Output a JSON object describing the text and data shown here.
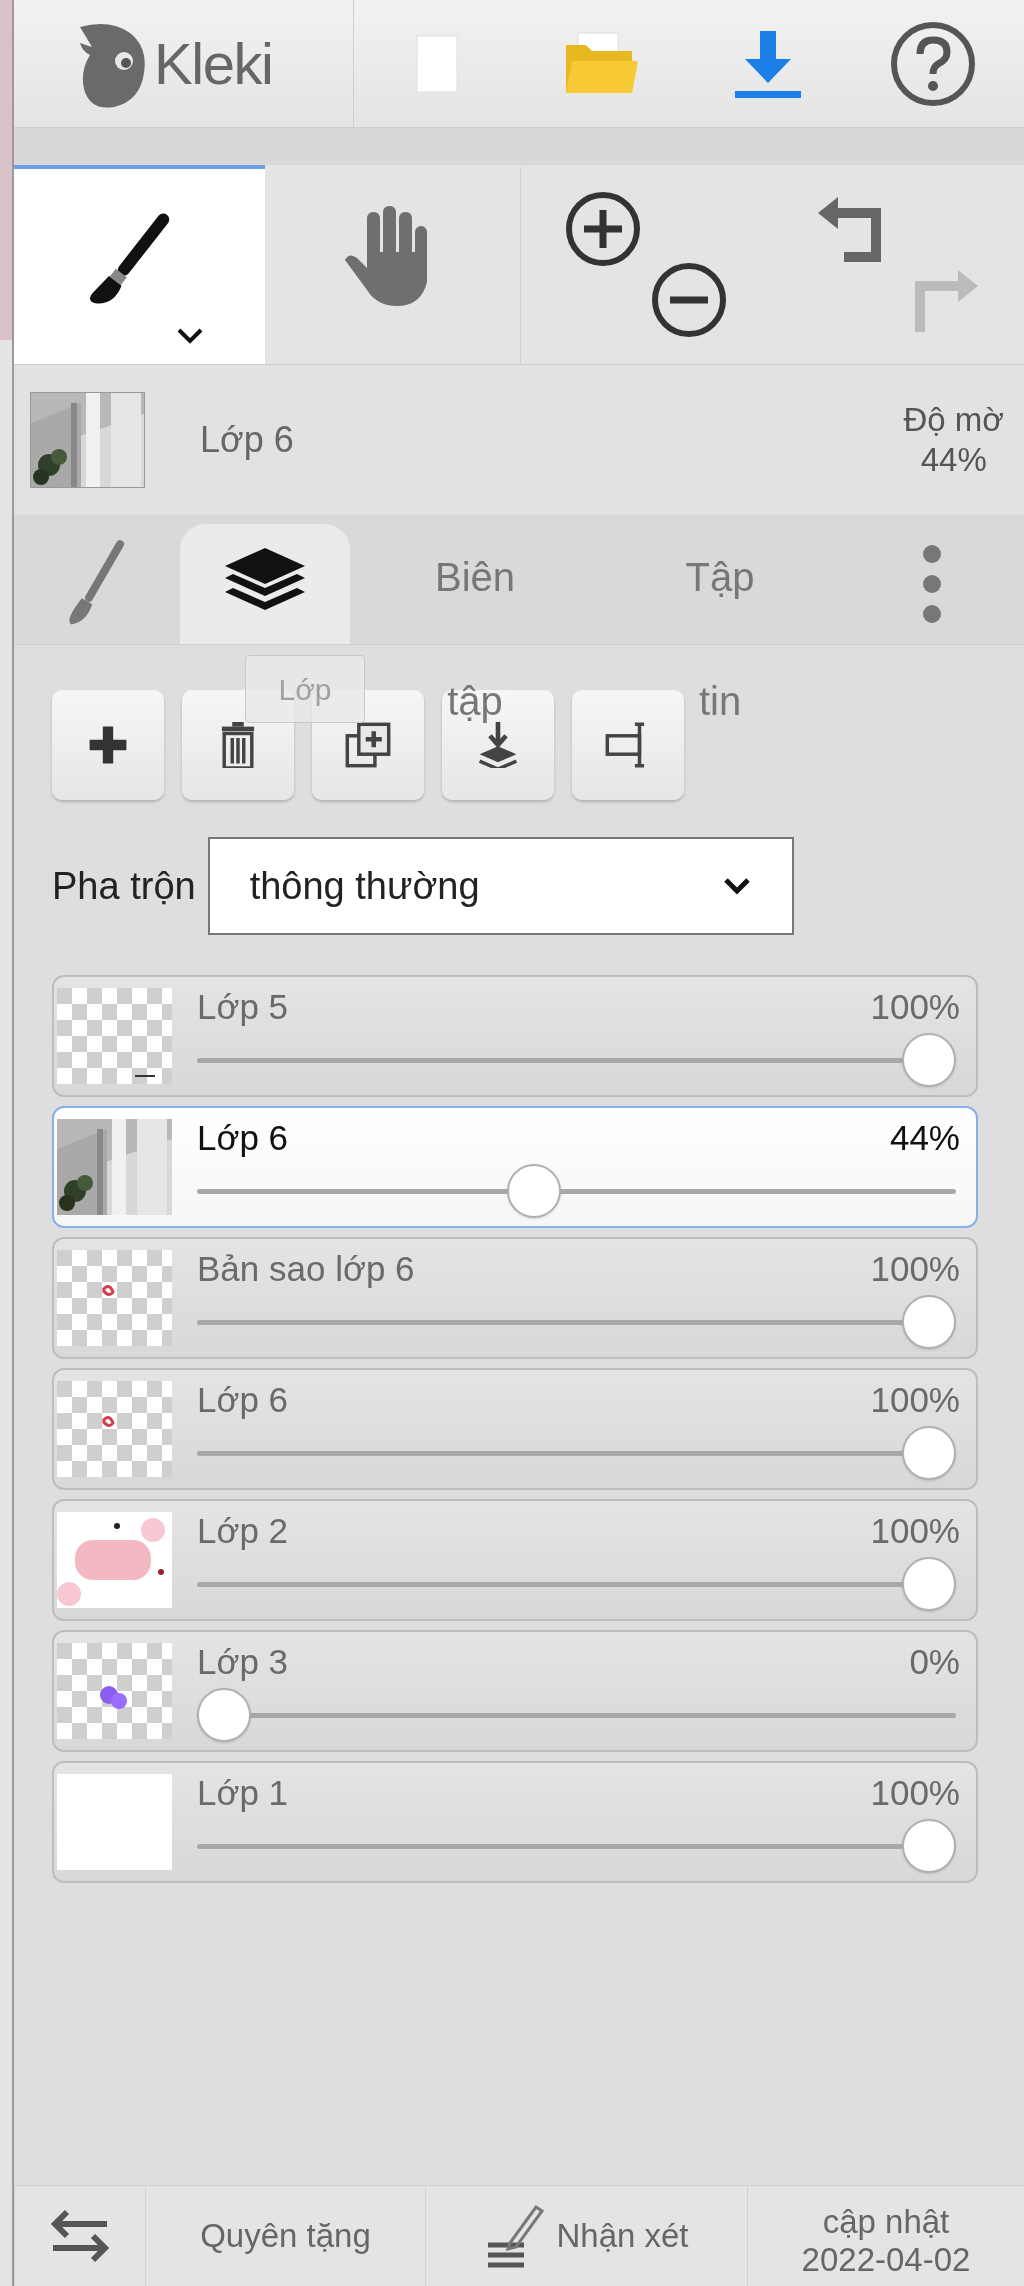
{
  "header": {
    "logo_text": "Kleki",
    "actions": [
      {
        "kind": "new"
      },
      {
        "kind": "open"
      },
      {
        "kind": "save"
      },
      {
        "kind": "help"
      }
    ]
  },
  "tools": [
    {
      "kind": "brush",
      "selected": true
    },
    {
      "kind": "hand",
      "selected": false
    }
  ],
  "history": {
    "undo_disabled": false,
    "redo_disabled": true
  },
  "current_layer": {
    "name": "Lớp 6",
    "opacity_label": "Độ mờ",
    "opacity": "44%"
  },
  "tabs": [
    {
      "kind": "brush",
      "selected": false
    },
    {
      "kind": "layers",
      "selected": true
    },
    {
      "kind": "text",
      "label": "Biên tập",
      "selected": false
    },
    {
      "kind": "text",
      "label": "Tập tin",
      "selected": false
    },
    {
      "kind": "more",
      "selected": false
    }
  ],
  "tooltip": "Lớp",
  "layer_actions": [
    {
      "kind": "add"
    },
    {
      "kind": "delete"
    },
    {
      "kind": "duplicate"
    },
    {
      "kind": "merge"
    },
    {
      "kind": "rename"
    }
  ],
  "blend": {
    "label": "Pha trộn",
    "value": "thông thường"
  },
  "layers": [
    {
      "name": "Lớp 5",
      "opacity": "100%",
      "level": 1,
      "selected": false,
      "kind": "transparent"
    },
    {
      "name": "Lớp 6",
      "opacity": "44%",
      "level": 0.44,
      "selected": true
    },
    {
      "name": "Bản sao lớp 6",
      "opacity": "100%",
      "level": 1,
      "selected": false,
      "kind": "sketch"
    },
    {
      "name": "Lớp 6",
      "opacity": "100%",
      "level": 1,
      "selected": false,
      "kind": "sketch"
    },
    {
      "name": "Lớp 2",
      "opacity": "100%",
      "level": 1,
      "selected": false,
      "kind": "blob"
    },
    {
      "name": "Lớp 3",
      "opacity": "0%",
      "level": 0,
      "selected": false,
      "kind": "violet"
    },
    {
      "name": "Lớp 1",
      "opacity": "100%",
      "level": 1,
      "selected": false,
      "kind": "white"
    }
  ],
  "footer": [
    {
      "kind": "swap"
    },
    {
      "kind": "text",
      "label": "Quyên tặng"
    },
    {
      "kind": "comment",
      "label": "Nhận xét"
    },
    {
      "kind": "text",
      "label": "cập nhật 2022-04-02"
    }
  ]
}
